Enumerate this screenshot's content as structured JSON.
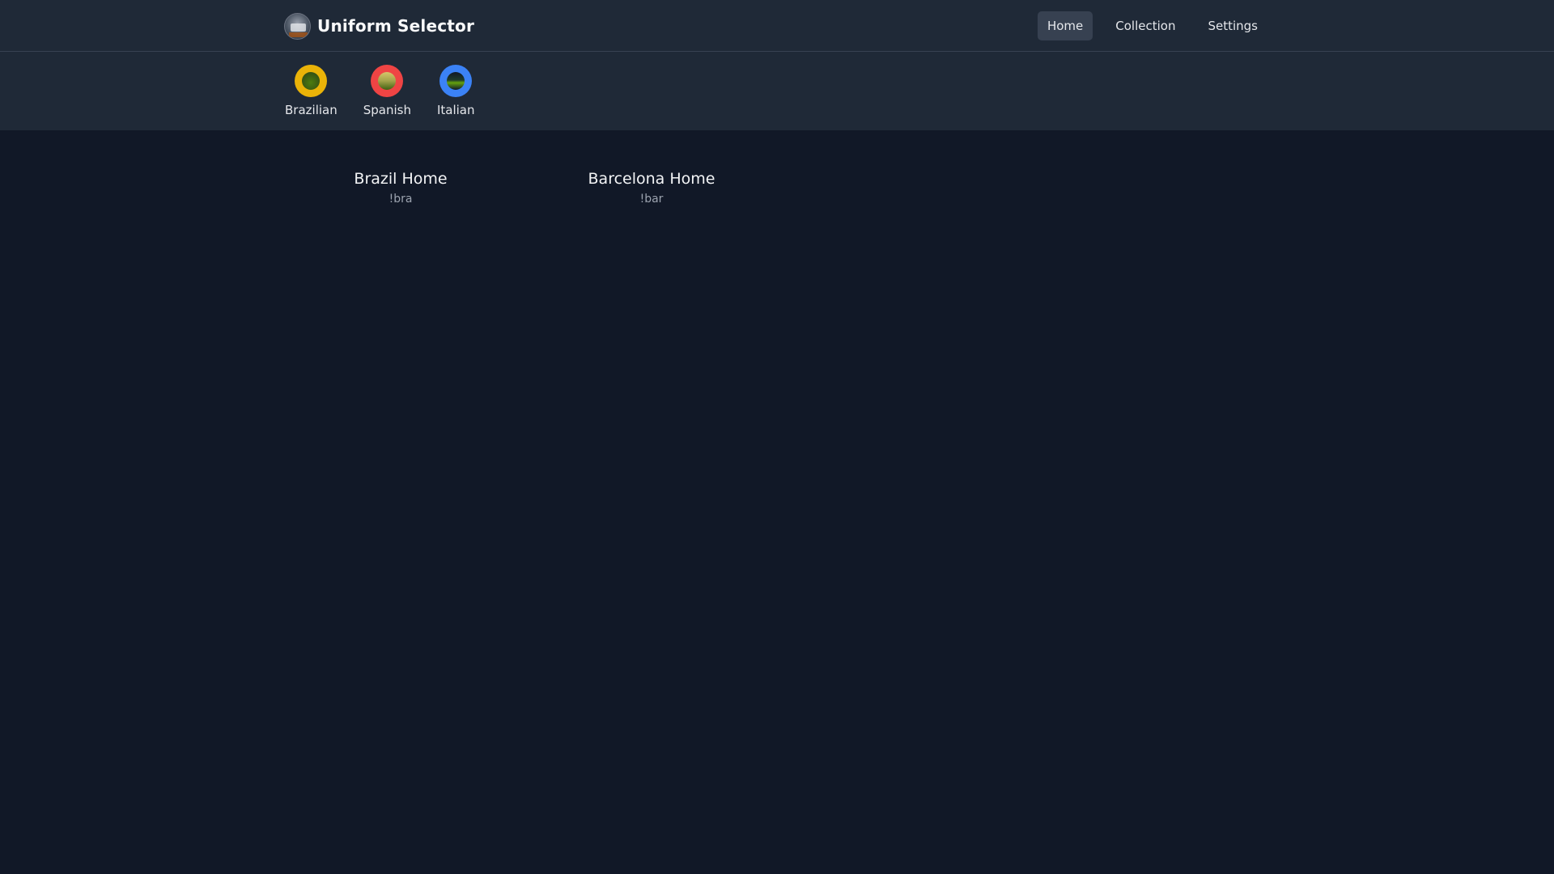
{
  "app": {
    "title": "Uniform Selector",
    "logo_icon": "team-photo-logo-icon"
  },
  "nav": {
    "items": [
      {
        "label": "Home",
        "active": true
      },
      {
        "label": "Collection",
        "active": false
      },
      {
        "label": "Settings",
        "active": false
      }
    ]
  },
  "categories": [
    {
      "label": "Brazilian",
      "icon": "brazil-badge-icon",
      "color": "#eab308",
      "inner_color": "#365314"
    },
    {
      "label": "Spanish",
      "icon": "spain-badge-icon",
      "color": "#ef4444",
      "inner_color": "#a3a34a"
    },
    {
      "label": "Italian",
      "icon": "italy-badge-icon",
      "color": "#3b82f6",
      "inner_color": "#1e3a2a"
    }
  ],
  "uniforms": [
    {
      "title": "Brazil Home",
      "code": "!bra"
    },
    {
      "title": "Barcelona Home",
      "code": "!bar"
    }
  ]
}
